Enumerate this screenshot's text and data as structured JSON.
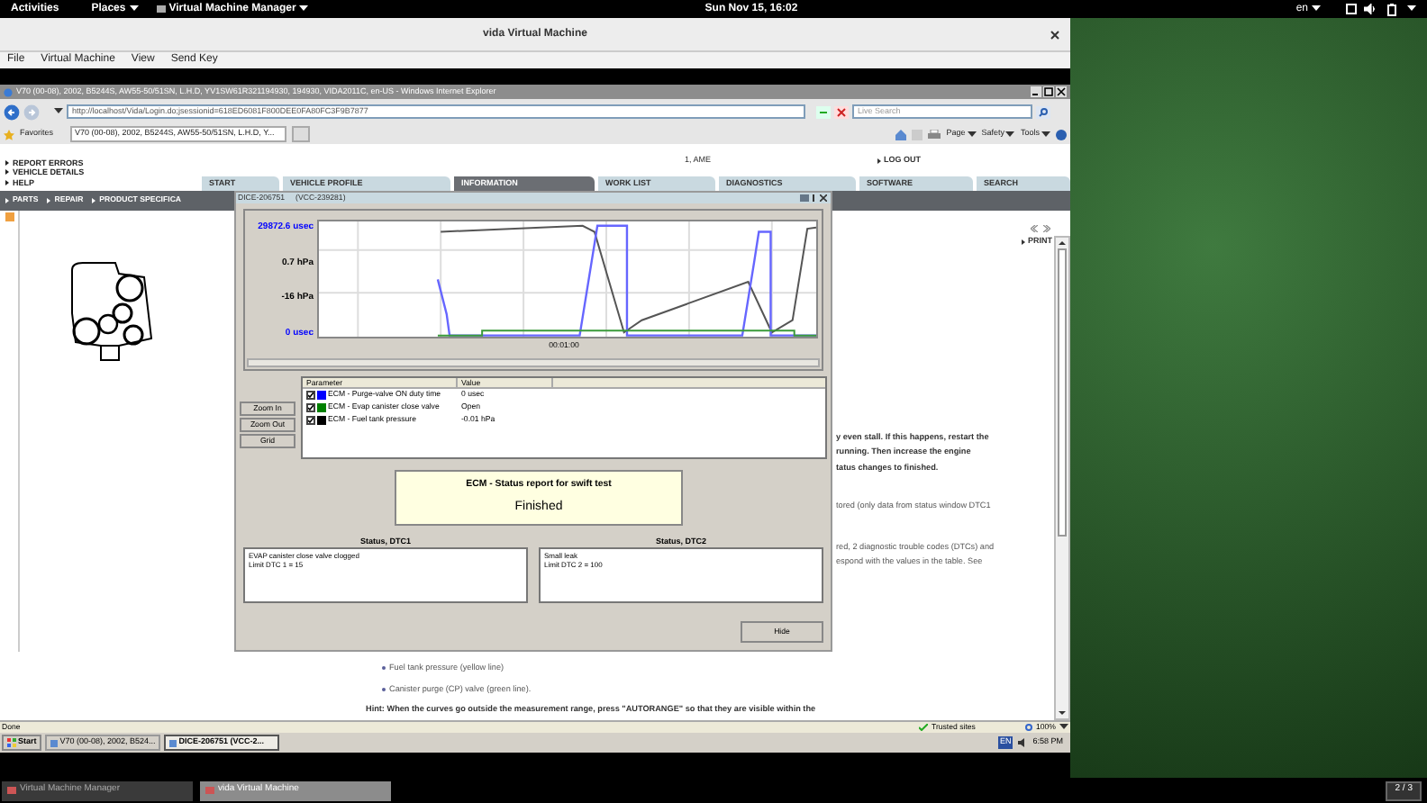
{
  "top_bar": {
    "activities": "Activities",
    "places": "Places",
    "app_menu": "Virtual Machine Manager",
    "clock": "Sun Nov 15, 16:02",
    "language": "en"
  },
  "vm_window": {
    "title": "vida Virtual Machine",
    "menu": [
      "File",
      "Virtual Machine",
      "View",
      "Send Key"
    ]
  },
  "browser": {
    "title": "V70 (00-08), 2002, B5244S, AW55-50/51SN, L.H.D, YV1SW61R321194930, 194930, VIDA2011C, en-US - Windows Internet Explorer",
    "address": "http://localhost/Vida/Login.do;jsessionid=618ED6081F800DEE0FA80FC3F9B7877",
    "search_placeholder": "Live Search",
    "favorites": "Favorites",
    "tab": "V70 (00-08), 2002, B5244S, AW55-50/51SN, L.H.D, Y...",
    "commands": [
      "Page",
      "Safety",
      "Tools"
    ],
    "status": "Done",
    "zone": "Trusted sites",
    "zoom": "100%"
  },
  "page": {
    "links": [
      "REPORT ERRORS",
      "VEHICLE DETAILS",
      "HELP"
    ],
    "user": "1, AME",
    "logout": "LOG OUT",
    "tabs": [
      {
        "label": "START",
        "selected": false
      },
      {
        "label": "VEHICLE PROFILE",
        "selected": false
      },
      {
        "label": "INFORMATION",
        "selected": true
      },
      {
        "label": "WORK LIST",
        "selected": false
      },
      {
        "label": "DIAGNOSTICS",
        "selected": false
      },
      {
        "label": "SOFTWARE",
        "selected": false
      },
      {
        "label": "SEARCH",
        "selected": false
      }
    ],
    "subnav": [
      "PARTS",
      "REPAIR",
      "PRODUCT SPECIFICA"
    ],
    "print": "PRINT",
    "paragraphs": [
      {
        "kind": "strong",
        "lines": [
          "y even stall. If this happens, restart the",
          "running. Then increase the engine",
          "tatus changes to finished."
        ]
      },
      {
        "kind": "normal",
        "lines": [
          "tored (only data from status window DTC1"
        ]
      },
      {
        "kind": "normal",
        "lines": [
          "red, 2 diagnostic trouble codes (DTCs) and",
          "espond with the values in the table. See"
        ]
      }
    ],
    "bullets": [
      "Fuel tank pressure (yellow line)",
      "Canister purge (CP) valve (green line)."
    ],
    "hint": "Hint: When the curves go outside the measurement range, press \"AUTORANGE\" so that they are visible within the"
  },
  "dialog": {
    "title": "DICE-206751",
    "subtitle": "(VCC-239281)",
    "axis_labels": [
      {
        "text": "29872.6 usec",
        "color": "#0000ff"
      },
      {
        "text": "0.7 hPa",
        "color": "#000000"
      },
      {
        "text": "-16 hPa",
        "color": "#000000"
      },
      {
        "text": "0 usec",
        "color": "#0000ff"
      }
    ],
    "time_label": "00:01:00",
    "columns": [
      "Parameter",
      "Value"
    ],
    "parameters": [
      {
        "name": "ECM - Purge-valve ON duty time",
        "value": "0 usec",
        "checked": true,
        "color": "#0000ff"
      },
      {
        "name": "ECM - Evap canister close valve",
        "value": "Open",
        "checked": true,
        "color": "#008000"
      },
      {
        "name": "ECM - Fuel tank pressure",
        "value": "-0.01 hPa",
        "checked": true,
        "color": "#000000"
      }
    ],
    "buttons": [
      "Zoom In",
      "Zoom Out",
      "Grid"
    ],
    "status_title": "ECM - Status report for swift test",
    "status": "Finished",
    "dtc": [
      {
        "title": "Status, DTC1",
        "lines": [
          "EVAP canister close valve clogged",
          "Limit DTC 1 = 15"
        ]
      },
      {
        "title": "Status, DTC2",
        "lines": [
          "Small leak",
          "Limit DTC 2 = 100"
        ]
      }
    ],
    "hide": "Hide"
  },
  "xp_taskbar": {
    "start": "Start",
    "tasks": [
      {
        "label": "V70 (00-08), 2002, B524...",
        "selected": false
      },
      {
        "label": "DICE-206751  (VCC-2...",
        "selected": true
      }
    ],
    "language": "EN",
    "clock": "6:58 PM"
  },
  "dock": {
    "windows": [
      {
        "label": "Virtual Machine Manager",
        "selected": false
      },
      {
        "label": "vida Virtual Machine",
        "selected": true
      }
    ],
    "workspace": "2 / 3"
  }
}
